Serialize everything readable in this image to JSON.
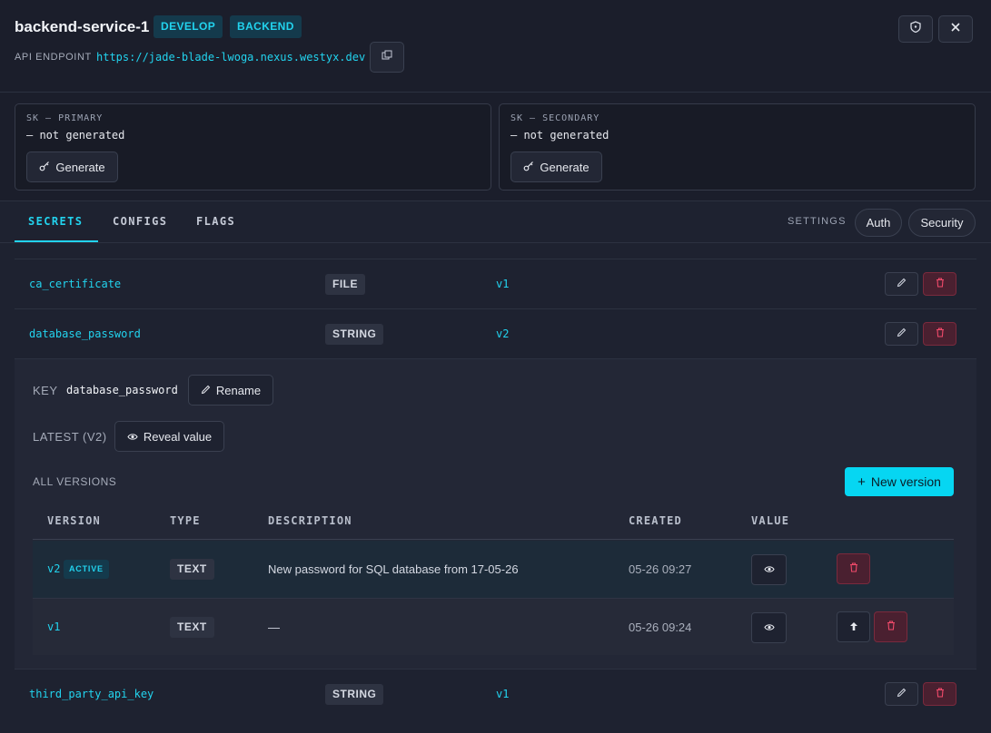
{
  "header": {
    "title": "backend-service-1",
    "badges": [
      "DEVELOP",
      "BACKEND"
    ],
    "endpoint_label": "API ENDPOINT",
    "endpoint_url": "https://jade-blade-lwoga.nexus.westyx.dev"
  },
  "keys": [
    {
      "label": "SK — PRIMARY",
      "value": "— not generated",
      "button": "Generate"
    },
    {
      "label": "SK — SECONDARY",
      "value": "— not generated",
      "button": "Generate"
    }
  ],
  "tabs": {
    "items": [
      "SECRETS",
      "CONFIGS",
      "FLAGS"
    ],
    "active": "SECRETS",
    "settings_label": "SETTINGS",
    "settings_buttons": [
      "Auth",
      "Security"
    ]
  },
  "secrets": [
    {
      "name": "ca_certificate",
      "type": "FILE",
      "version": "v1"
    },
    {
      "name": "database_password",
      "type": "STRING",
      "version": "v2",
      "expanded": true
    },
    {
      "name": "third_party_api_key",
      "type": "STRING",
      "version": "v1"
    }
  ],
  "detail": {
    "key_label": "KEY",
    "key_value": "database_password",
    "rename_button": "Rename",
    "latest_label": "LATEST (V2)",
    "reveal_button": "Reveal value",
    "all_versions_label": "ALL VERSIONS",
    "new_version_button": "New version",
    "columns": [
      "VERSION",
      "TYPE",
      "DESCRIPTION",
      "CREATED",
      "VALUE"
    ],
    "versions": [
      {
        "version": "v2",
        "active_label": "ACTIVE",
        "type": "TEXT",
        "description": "New password for SQL database from 17-05-26",
        "created": "05-26 09:27"
      },
      {
        "version": "v1",
        "type": "TEXT",
        "description": "—",
        "created": "05-26 09:24"
      }
    ]
  },
  "icons": {
    "copy": "copy-icon",
    "shield": "shield-icon",
    "close": "close-icon",
    "key": "key-icon",
    "pencil": "pencil-icon",
    "trash": "trash-icon",
    "eye": "eye-icon",
    "plus": "plus-icon",
    "arrow_up": "arrow-up-icon"
  },
  "colors": {
    "accent": "#22d3ee",
    "danger": "#e23a5a",
    "background": "#1e2230"
  }
}
